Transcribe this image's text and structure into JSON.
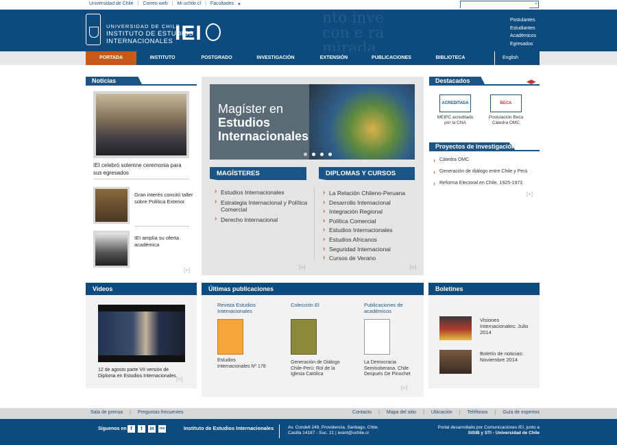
{
  "topbar": {
    "links": [
      "Universidad de Chile",
      "Correo web",
      "Mi uchile.cl",
      "Facultades"
    ],
    "search_placeholder": ""
  },
  "header": {
    "bg_text": [
      "nto inve",
      "con e ra",
      "mirada"
    ],
    "uni_line1": "UNIVERSIDAD DE CHILE",
    "uni_line2": "INSTITUTO DE ESTUDIOS",
    "uni_line3": "INTERNACIONALES",
    "mark": "IEI",
    "side_links": [
      "Postulantes",
      "Estudiantes",
      "Académicos",
      "Egresados"
    ]
  },
  "nav": {
    "items": [
      "PORTADA",
      "INSTITUTO",
      "POSTGRADO",
      "INVESTIGACIÓN",
      "EXTENSIÓN",
      "PUBLICACIONES",
      "BIBLIOTECA"
    ],
    "english": "English"
  },
  "noticias": {
    "title": "Noticias",
    "main_caption": "IEI celebró solemne ceremonia para sus egresados",
    "items": [
      "Gran interés concitó taller sobre Política Exterior",
      "IEI amplía su oferta académica"
    ],
    "more": "[+]"
  },
  "banner": {
    "line1": "Magíster en",
    "line2": "Estudios",
    "line3": "Internacionales"
  },
  "magisteres": {
    "title": "MAGÍSTERES",
    "items": [
      "Estudios Internacionales",
      "Estrategia Internacional y Política Comercial",
      "Derecho Internacional"
    ],
    "more": "[+]"
  },
  "diplomas": {
    "title": "DIPLOMAS Y CURSOS",
    "items": [
      "La Relación Chileno-Peruana",
      "Desarrollo Internacional",
      "Integración Regional",
      "Política Comercial",
      "Estudios Internacionales",
      "Estudios Africanos",
      "Seguridad Internacional",
      "Cursos de Verano"
    ],
    "more": "[+]"
  },
  "destacados": {
    "title": "Destacados",
    "badges": [
      {
        "icon_text": "ACREDITADA",
        "label": "MEIPC acreditado por la CNA"
      },
      {
        "icon_text": "BECA",
        "label": "Postulación Beca Cátedra OMC"
      }
    ]
  },
  "proyectos": {
    "title": "Proyectos de investigación",
    "items": [
      "Cátedra OMC",
      "Generación de diálogo entre Chile y Perú",
      "Reforma Electoral en Chile, 1925-1973"
    ],
    "more": "[+]"
  },
  "videos": {
    "title": "Videos",
    "caption": "12 de agosto parte VII versión de Diploma en Estudios Internacionales",
    "more": "[+]"
  },
  "publicaciones": {
    "title": "Últimas publicaciones",
    "items": [
      {
        "title": "Revista Estudios Internacionales",
        "caption": "Estudios Internacionales Nº 178"
      },
      {
        "title": "Colección El",
        "caption": "Generación de Diálogo Chile-Perú: Rol de la Iglesia Católica"
      },
      {
        "title": "Publicaciones de académicos",
        "caption": "La Democracia Semisoberana. Chile Después De Pinochet"
      }
    ],
    "more": "[+]"
  },
  "boletines": {
    "title": "Boletines",
    "items": [
      "Visiones Internacionales: Julio 2014",
      "Boletín de noticias: Noviembre 2014"
    ]
  },
  "footer_links": {
    "left": [
      "Sala de prensa",
      "Preguntas frecuentes"
    ],
    "right": [
      "Contacto",
      "Mapa del sitio",
      "Ubicación",
      "Teléfonos",
      "Guía de expertos"
    ]
  },
  "footer": {
    "follow": "Síguenos en",
    "social": [
      "f",
      "t",
      "in",
      "rss"
    ],
    "institute": "Instituto de Estudios Internacionales",
    "address1": "Av. Condell 249, Providencia. Santiago. Chile.",
    "address2": "Casilla 14187 - Suc. 21 | iesint@uchile.cl",
    "credit1": "Portal desarrollado por Comunicaciones IEI, junto a",
    "credit2": "SISIB y STI - Universidad de Chile"
  },
  "colors": {
    "navy": "#0d4a7d",
    "accent_orange": "#c65a16"
  }
}
